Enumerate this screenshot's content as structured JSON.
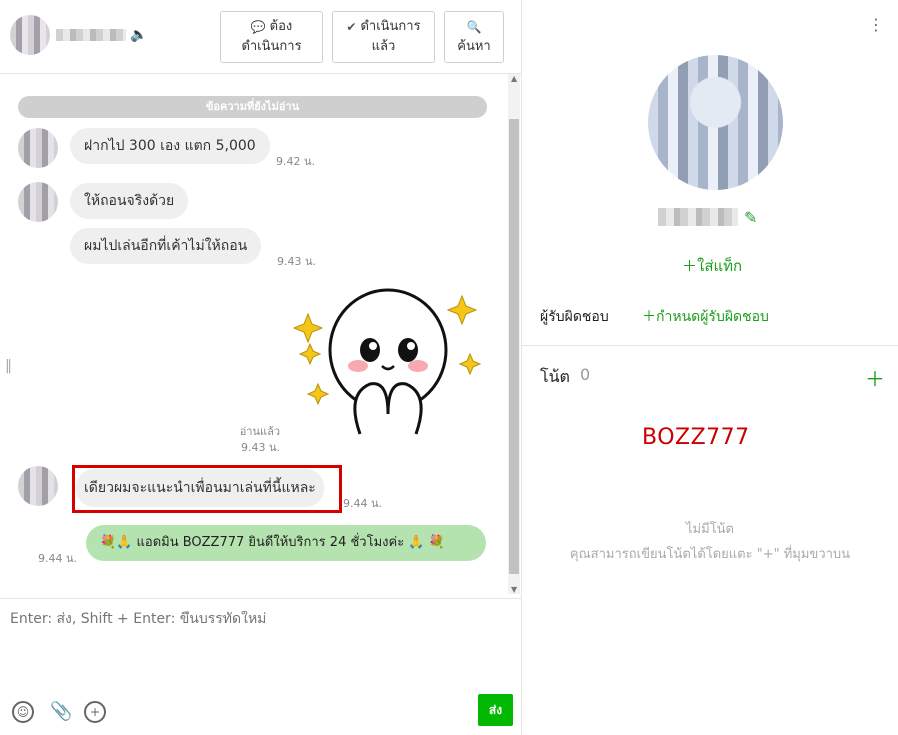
{
  "header": {
    "contact_name": "",
    "btn_followup_line1": "ต้อง",
    "btn_followup_line2": "ดำเนินการ",
    "btn_done_line1": "ดำเนินการ",
    "btn_done_line2": "แล้ว",
    "btn_search": "ค้นหา"
  },
  "chat": {
    "unread_divider": "ข้อความที่ยังไม่อ่าน",
    "messages": [
      {
        "text": "ฝากไป 300 เอง แตก 5,000",
        "time": "9.42 น."
      },
      {
        "text": "ให้ถอนจริงด้วย"
      },
      {
        "text": "ผมไปเล่นอีกที่เค้าไม่ให้ถอน",
        "time": "9.43 น."
      },
      {
        "text": "เดียวผมจะแนะนำเพื่อนมาเล่นที่นี้แหละ",
        "time": "9.44 น."
      }
    ],
    "read_label": "อ่านแล้ว",
    "read_time": "9.43 น.",
    "outgoing": {
      "time": "9.44 น.",
      "emoji_left": "💐🙏",
      "text": "แอดมิน BOZZ777 ยินดีให้บริการ 24 ชั่วโมงค่ะ",
      "emoji_right": "🙏 💐"
    }
  },
  "composer": {
    "placeholder": "Enter: ส่ง, Shift + Enter: ขึ้นบรรทัดใหม่",
    "send_label": "ส่ง"
  },
  "profile": {
    "add_tag": "ใส่แท็ก",
    "assignee_label": "ผู้รับผิดชอบ",
    "assign_link": "กำหนดผู้รับผิดชอบ",
    "notes_title": "โน้ต",
    "notes_count": "0",
    "brand_note": "BOZZ777",
    "empty_title": "ไม่มีโน้ต",
    "empty_desc": "คุณสามารถเขียนโน้ตได้โดยแตะ \"+\" ที่มุมขวาบน"
  },
  "colors": {
    "accent_green": "#00b900",
    "highlight_red": "#d60000",
    "outgoing_bubble": "#b5e3b0"
  }
}
